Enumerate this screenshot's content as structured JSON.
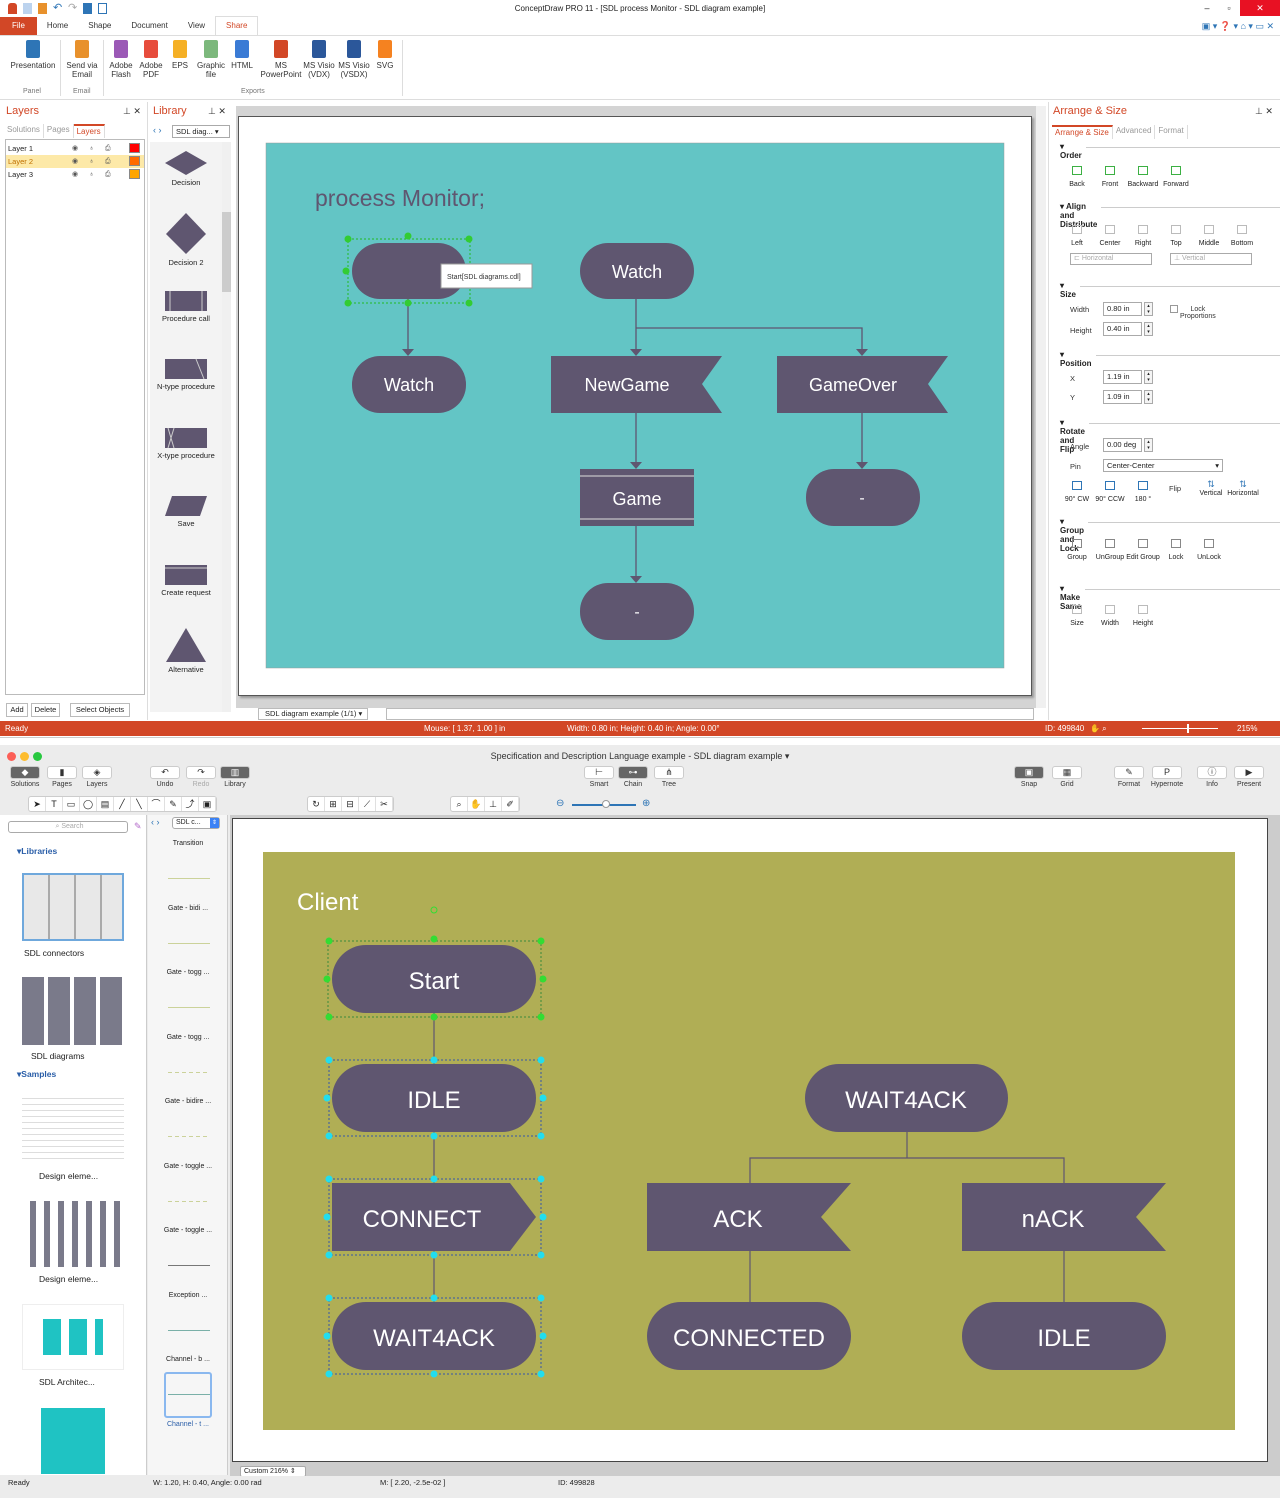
{
  "top_window": {
    "title": "ConceptDraw PRO 11 - [SDL process Monitor - SDL diagram example]",
    "menu_tabs": [
      "File",
      "Home",
      "Shape",
      "Document",
      "View",
      "Share"
    ],
    "active_tab": "Share",
    "ribbon": {
      "buttons": [
        {
          "label": "Presentation",
          "icon": "presentation-icon",
          "color": "#2e75b6"
        },
        {
          "label": "Send via Email",
          "icon": "email-icon",
          "color": "#e8912c"
        },
        {
          "label": "Adobe Flash",
          "icon": "swf-file-icon",
          "color": "#9b59b6"
        },
        {
          "label": "Adobe PDF",
          "icon": "pdf-file-icon",
          "color": "#e74c3c"
        },
        {
          "label": "EPS",
          "icon": "eps-file-icon",
          "color": "#f5b025"
        },
        {
          "label": "Graphic file",
          "icon": "image-file-icon",
          "color": "#7cb87c"
        },
        {
          "label": "HTML",
          "icon": "html-file-icon",
          "color": "#3a7bd5"
        },
        {
          "label": "MS PowerPoint",
          "icon": "powerpoint-icon",
          "color": "#d24726"
        },
        {
          "label": "MS Visio (VDX)",
          "icon": "visio-vdx-icon",
          "color": "#2b579a"
        },
        {
          "label": "MS Visio (VSDX)",
          "icon": "visio-vsdx-icon",
          "color": "#2b579a"
        },
        {
          "label": "SVG",
          "icon": "svg-file-icon",
          "color": "#f58220"
        }
      ],
      "groups": [
        "Panel",
        "Email",
        "Exports"
      ]
    },
    "layers_panel": {
      "title": "Layers",
      "tabs": [
        "Solutions",
        "Pages",
        "Layers"
      ],
      "layers": [
        {
          "name": "Layer 1",
          "color": "#ff0000"
        },
        {
          "name": "Layer 2",
          "color": "#ff6a00",
          "selected": true
        },
        {
          "name": "Layer 3",
          "color": "#ffa500"
        }
      ],
      "buttons": [
        "Add",
        "Delete",
        "Select Objects"
      ]
    },
    "library_panel": {
      "title": "Library",
      "selector": "SDL diag...",
      "items": [
        "Decision",
        "Decision 2",
        "Procedure call",
        "N-type procedure",
        "X-type procedure",
        "Save",
        "Create request",
        "Alternative"
      ]
    },
    "diagram": {
      "background": "#63c5c5",
      "shape_color": "#5f5670",
      "title": "process Monitor;",
      "tooltip": "Start[SDL diagrams.cdl]",
      "shapes": [
        "Watch",
        "Watch",
        "NewGame",
        "GameOver",
        "Game",
        "-",
        "-"
      ]
    },
    "page_tab": "SDL diagram example (1/1)",
    "arrange_panel": {
      "title": "Arrange & Size",
      "tabs": [
        "Arrange & Size",
        "Advanced",
        "Format"
      ],
      "order": {
        "title": "Order",
        "buttons": [
          "Back",
          "Front",
          "Backward",
          "Forward"
        ]
      },
      "align": {
        "title": "Align and Distribute",
        "buttons": [
          "Left",
          "Center",
          "Right",
          "Top",
          "Middle",
          "Bottom"
        ],
        "horizontal": "Horizontal",
        "vertical": "Vertical"
      },
      "size": {
        "title": "Size",
        "width_label": "Width",
        "width": "0.80 in",
        "height_label": "Height",
        "height": "0.40 in",
        "lock": "Lock Proportions"
      },
      "position": {
        "title": "Position",
        "x_label": "X",
        "x": "1.19 in",
        "y_label": "Y",
        "y": "1.09 in"
      },
      "rotate": {
        "title": "Rotate and Flip",
        "angle_label": "Angle",
        "angle": "0.00 deg",
        "pin_label": "Pin",
        "pin": "Center-Center",
        "buttons": [
          "90° CW",
          "90° CCW",
          "180 °"
        ],
        "flip": "Flip",
        "flip_buttons": [
          "Vertical",
          "Horizontal"
        ]
      },
      "group": {
        "title": "Group and Lock",
        "buttons": [
          "Group",
          "UnGroup",
          "Edit Group",
          "Lock",
          "UnLock"
        ]
      },
      "same": {
        "title": "Make Same",
        "buttons": [
          "Size",
          "Width",
          "Height"
        ]
      }
    },
    "status": {
      "ready": "Ready",
      "mouse": "Mouse: [ 1.37, 1.00 ] in",
      "dims": "Width: 0.80 in;  Height: 0.40 in;  Angle: 0.00°",
      "id": "ID: 499840",
      "zoom": "215%",
      "zoom_fraction": 0.6
    }
  },
  "bottom_window": {
    "title": "Specification and Description Language example - SDL diagram example",
    "toolbar": {
      "left": [
        "Solutions",
        "Pages",
        "Layers"
      ],
      "history": [
        "Undo",
        "Redo",
        "Library"
      ],
      "center": [
        "Smart",
        "Chain",
        "Tree"
      ],
      "snap": [
        "Snap",
        "Grid"
      ],
      "right": [
        "Format",
        "Hypernote",
        "Info",
        "Present"
      ]
    },
    "sidebar": {
      "search_placeholder": "Search",
      "libraries_label": "Libraries",
      "libraries": [
        "SDL connectors",
        "SDL diagrams"
      ],
      "samples_label": "Samples",
      "samples": [
        "Design eleme...",
        "Design eleme...",
        "SDL Architec..."
      ]
    },
    "library": {
      "selector": "SDL c...",
      "items": [
        "Transition",
        "Gate - bidi ...",
        "Gate - togg ...",
        "Gate - togg ...",
        "Gate - bidire ...",
        "Gate - toggle ...",
        "Gate - toggle ...",
        "Exception  ...",
        "Channel - b ...",
        "Channel - t ..."
      ]
    },
    "diagram": {
      "background": "#b0ae55",
      "shape_color": "#5f5670",
      "title": "Client",
      "left_column": [
        "Start",
        "IDLE",
        "CONNECT",
        "WAIT4ACK"
      ],
      "right_top": "WAIT4ACK",
      "inputs": [
        "ACK",
        "nACK"
      ],
      "states": [
        "CONNECTED",
        "IDLE"
      ]
    },
    "zoom_select": "Custom 216%",
    "status": {
      "ready": "Ready",
      "dims": "W: 1.20,  H: 0.40,  Angle: 0.00 rad",
      "mouse": "M: [ 2.20, -2.5e-02 ]",
      "id": "ID: 499828"
    }
  }
}
